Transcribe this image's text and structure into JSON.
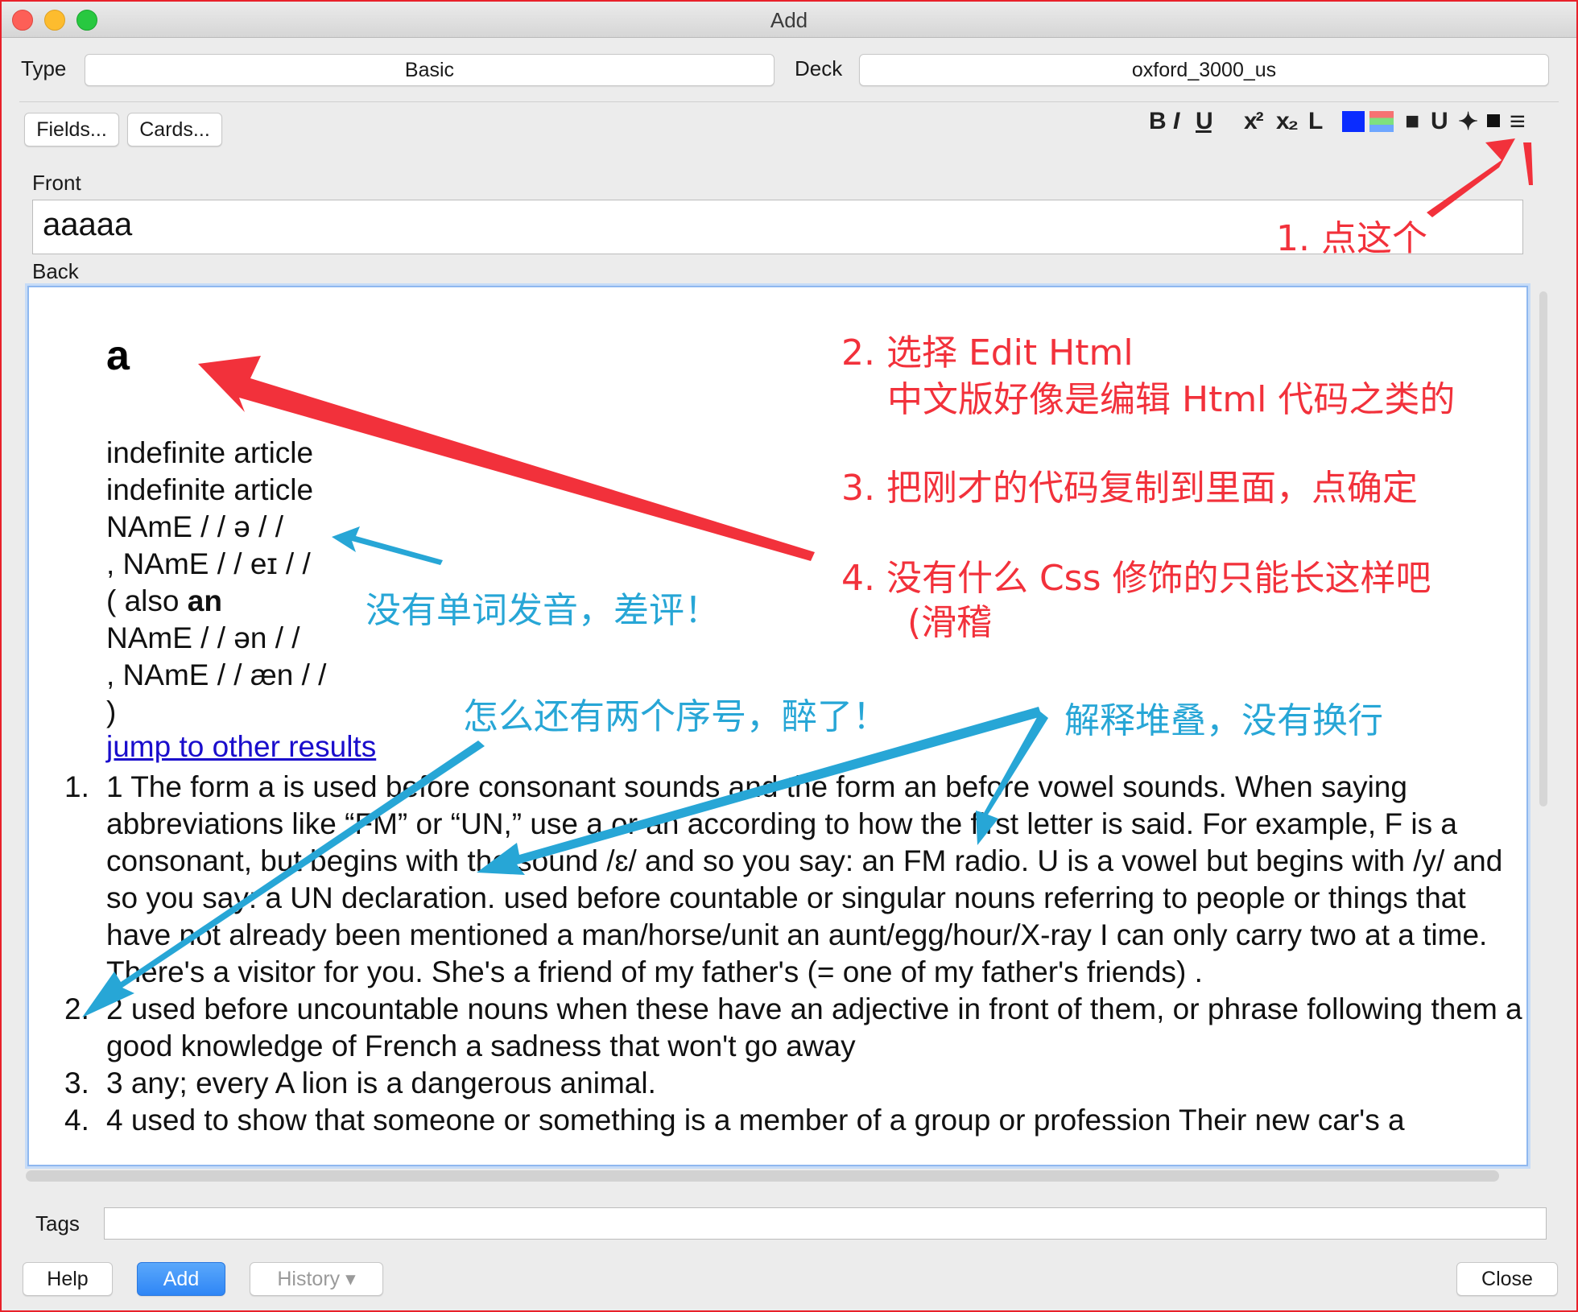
{
  "window": {
    "title": "Add"
  },
  "type_row": {
    "type_label": "Type",
    "type_value": "Basic",
    "deck_label": "Deck",
    "deck_value": "oxford_3000_us"
  },
  "buttons": {
    "fields": "Fields...",
    "cards": "Cards...",
    "help": "Help",
    "add": "Add",
    "history": "History ▾",
    "close": "Close"
  },
  "toolbar": {
    "menu_icon": "≡"
  },
  "front": {
    "label": "Front",
    "value": "aaaaa"
  },
  "back": {
    "label": "Back",
    "headword": "a",
    "lines": [
      "indefinite article",
      "indefinite article",
      "NAmE / / ə / /",
      ", NAmE / / eɪ / /",
      "( also ",
      "NAmE / / ən / /",
      ", NAmE / / æn / /",
      ")"
    ],
    "also_bold": "an",
    "jump_link": "jump to other results",
    "senses": [
      {
        "num": "1.",
        "text": "1 The form a is used before consonant sounds and the form an before vowel sounds. When saying abbreviations like “FM” or “UN,” use a or an according to how the first letter is said. For example, F is a consonant, but begins with the sound /ɛ/ and so you say: an FM radio. U is a vowel but begins with /y/ and so you say: a UN declaration. used before countable or singular nouns referring to people or things that have not already been mentioned a man/horse/unit an aunt/egg/hour/X-ray I can only carry two at a time. There's a visitor for you. She's a friend of my father's (= one of my father's friends) ."
      },
      {
        "num": "2.",
        "text": "2 used before uncountable nouns when these have an adjective in front of them, or phrase following them a good knowledge of French a sadness that won't go away"
      },
      {
        "num": "3.",
        "text": "3 any; every A lion is a dangerous animal."
      },
      {
        "num": "4.",
        "text": "4 used to show that someone or something is a member of a group or profession Their new car's a"
      }
    ]
  },
  "tags": {
    "label": "Tags",
    "value": ""
  },
  "annotations": {
    "step1": "1. 点这个",
    "step2": "2. 选择 Edit Html",
    "step2b": "中文版好像是编辑 Html 代码之类的",
    "step3": "3. 把刚才的代码复制到里面，点确定",
    "step4": "4. 没有什么 Css 修饰的只能长这样吧",
    "step4b": "(滑稽",
    "no_audio": "没有单词发音，差评！",
    "two_numbers": "怎么还有两个序号，醉了！",
    "stacked": "解释堆叠，没有换行"
  },
  "colors": {
    "annotation_red": "#f2313b",
    "annotation_blue": "#27a6d6",
    "link": "#1a0dcc",
    "focus": "#8fb8ef"
  }
}
